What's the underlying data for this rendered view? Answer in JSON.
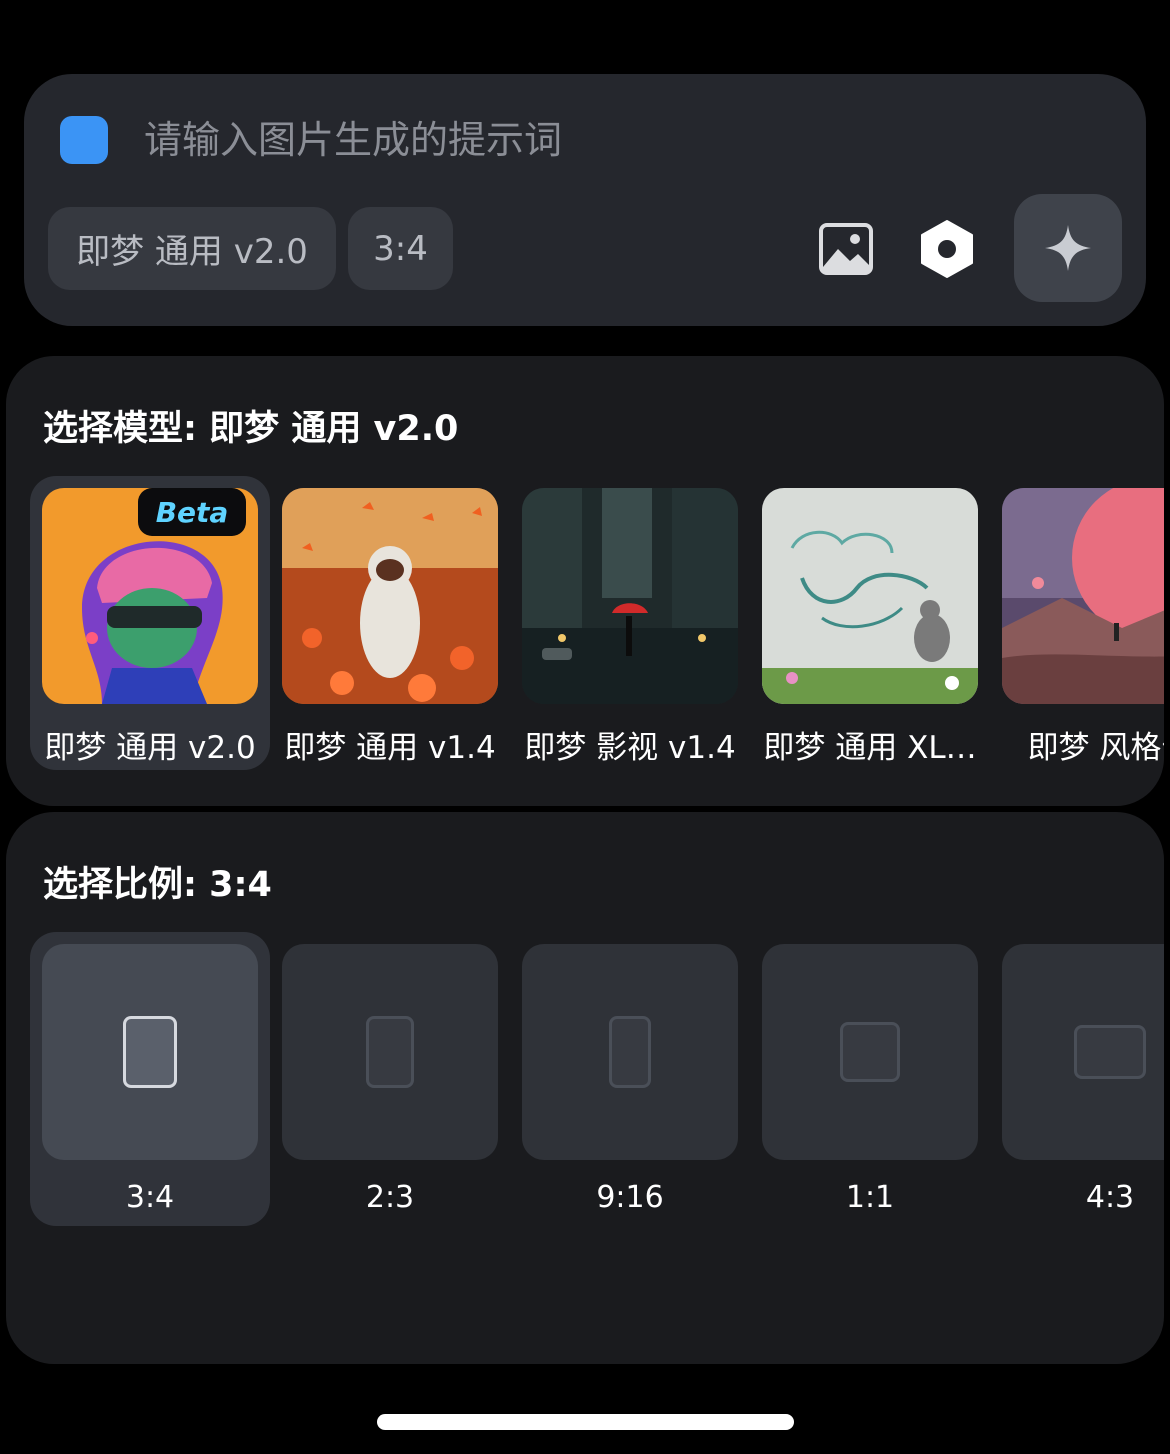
{
  "prompt": {
    "placeholder": "请输入图片生成的提示词",
    "model_chip": "即梦 通用 v2.0",
    "ratio_chip": "3:4"
  },
  "icons": {
    "logo": "app-logo-icon",
    "image": "image-upload-icon",
    "settings": "hexagon-settings-icon",
    "generate": "sparkle-icon"
  },
  "model_panel": {
    "title": "选择模型: 即梦 通用 v2.0",
    "items": [
      {
        "label": "即梦 通用 v2.0",
        "badge": "Beta",
        "selected": true
      },
      {
        "label": "即梦 通用 v1.4",
        "selected": false
      },
      {
        "label": "即梦 影视 v1.4",
        "selected": false
      },
      {
        "label": "即梦 通用 XL…",
        "selected": false
      },
      {
        "label": "即梦 风格化",
        "selected": false
      }
    ]
  },
  "ratio_panel": {
    "title": "选择比例: 3:4",
    "items": [
      {
        "label": "3:4",
        "selected": true
      },
      {
        "label": "2:3",
        "selected": false
      },
      {
        "label": "9:16",
        "selected": false
      },
      {
        "label": "1:1",
        "selected": false
      },
      {
        "label": "4:3",
        "selected": false
      }
    ]
  },
  "colors": {
    "accent": "#3b94f5",
    "beta": "#5fd3ff"
  }
}
